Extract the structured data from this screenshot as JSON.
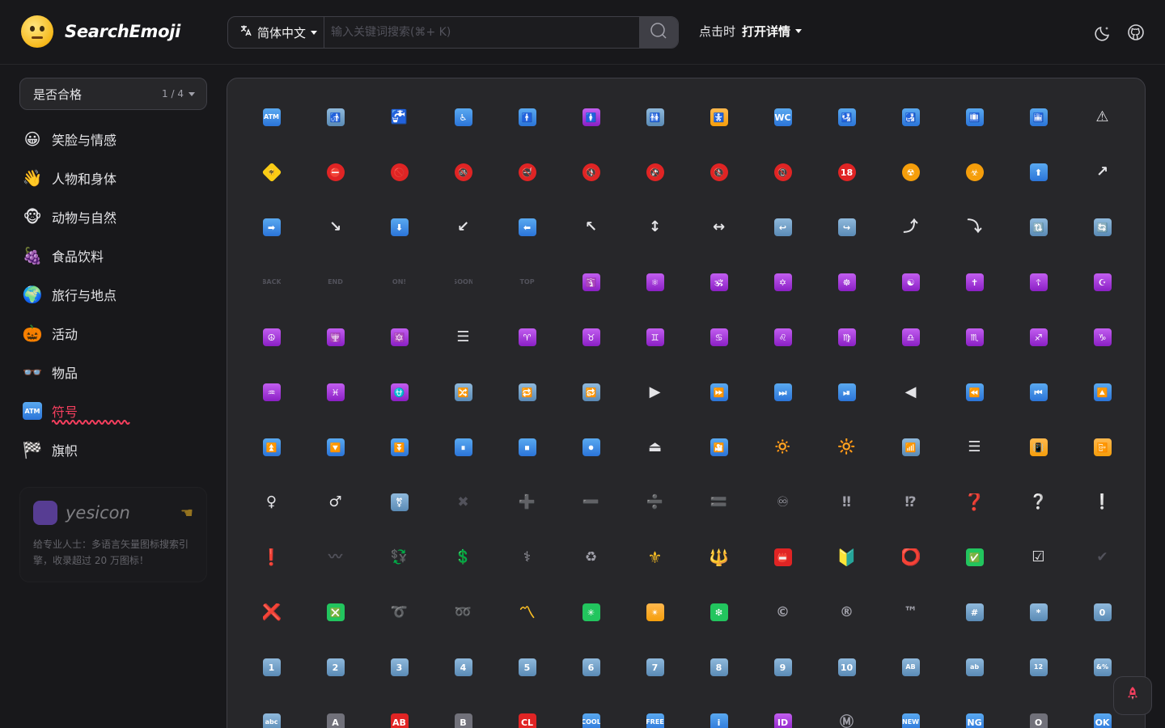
{
  "header": {
    "logo_text": "SearchEmoji",
    "language": "简体中文",
    "search_placeholder": "输入关键词搜索(⌘+ K)",
    "click_label": "点击时",
    "click_value": "打开详情"
  },
  "sidebar": {
    "filter_label": "是否合格",
    "filter_count": "1 / 4",
    "categories": [
      {
        "icon": "😀",
        "label": "笑脸与情感"
      },
      {
        "icon": "👋",
        "label": "人物和身体"
      },
      {
        "icon": "🐵",
        "label": "动物与自然"
      },
      {
        "icon": "🍇",
        "label": "食品饮料"
      },
      {
        "icon": "🌍",
        "label": "旅行与地点"
      },
      {
        "icon": "🎃",
        "label": "活动"
      },
      {
        "icon": "👓",
        "label": "物品"
      },
      {
        "icon": "ATM",
        "label": "符号"
      },
      {
        "icon": "🏁",
        "label": "旗帜"
      }
    ],
    "active_index": 7,
    "promo": {
      "brand": "yesicon",
      "description": "给专业人士：多语言矢量图标搜索引擎，收录超过 20 万图标！"
    }
  },
  "emojis": [
    {
      "c": "ATM",
      "s": "blue sm"
    },
    {
      "c": "🚮",
      "s": "lblue"
    },
    {
      "c": "🚰",
      "s": "grayplain"
    },
    {
      "c": "♿",
      "s": "blue"
    },
    {
      "c": "🚹",
      "s": "blue"
    },
    {
      "c": "🚺",
      "s": "purple"
    },
    {
      "c": "🚻",
      "s": "lblue"
    },
    {
      "c": "🚼",
      "s": "orange"
    },
    {
      "c": "WC",
      "s": "blue"
    },
    {
      "c": "🛂",
      "s": "blue"
    },
    {
      "c": "🛃",
      "s": "blue"
    },
    {
      "c": "🛄",
      "s": "blue"
    },
    {
      "c": "🛅",
      "s": "blue"
    },
    {
      "c": "⚠",
      "s": "whiteplain"
    },
    {
      "c": "🚸",
      "s": "yellow"
    },
    {
      "c": "⛔",
      "s": "redc"
    },
    {
      "c": "🚫",
      "s": "redc"
    },
    {
      "c": "🚳",
      "s": "redc"
    },
    {
      "c": "🚭",
      "s": "redc"
    },
    {
      "c": "🚯",
      "s": "redc"
    },
    {
      "c": "🚱",
      "s": "redc"
    },
    {
      "c": "🚷",
      "s": "redc"
    },
    {
      "c": "📵",
      "s": "redc"
    },
    {
      "c": "18",
      "s": "redc"
    },
    {
      "c": "☢",
      "s": "orangec"
    },
    {
      "c": "☣",
      "s": "orangec"
    },
    {
      "c": "⬆",
      "s": "blue"
    },
    {
      "c": "↗",
      "s": "whiteplain"
    },
    {
      "c": "➡",
      "s": "blue"
    },
    {
      "c": "↘",
      "s": "whiteplain"
    },
    {
      "c": "⬇",
      "s": "blue"
    },
    {
      "c": "↙",
      "s": "whiteplain"
    },
    {
      "c": "⬅",
      "s": "blue"
    },
    {
      "c": "↖",
      "s": "whiteplain"
    },
    {
      "c": "↕",
      "s": "whiteplain"
    },
    {
      "c": "↔",
      "s": "whiteplain"
    },
    {
      "c": "↩",
      "s": "lblue"
    },
    {
      "c": "↪",
      "s": "lblue"
    },
    {
      "c": "⤴",
      "s": "whiteplain"
    },
    {
      "c": "⤵",
      "s": "whiteplain"
    },
    {
      "c": "🔃",
      "s": "lblue"
    },
    {
      "c": "🔄",
      "s": "lblue"
    },
    {
      "c": "BACK",
      "s": "dimsm"
    },
    {
      "c": "END",
      "s": "dimsm"
    },
    {
      "c": "ON!",
      "s": "dimsm"
    },
    {
      "c": "SOON",
      "s": "dimsm"
    },
    {
      "c": "TOP",
      "s": "dimsm"
    },
    {
      "c": "🛐",
      "s": "purple"
    },
    {
      "c": "⚛",
      "s": "purple"
    },
    {
      "c": "🕉",
      "s": "purple"
    },
    {
      "c": "✡",
      "s": "purple"
    },
    {
      "c": "☸",
      "s": "purple"
    },
    {
      "c": "☯",
      "s": "purple"
    },
    {
      "c": "✝",
      "s": "purple"
    },
    {
      "c": "☦",
      "s": "purple"
    },
    {
      "c": "☪",
      "s": "purple"
    },
    {
      "c": "☮",
      "s": "purple"
    },
    {
      "c": "🕎",
      "s": "purple"
    },
    {
      "c": "🔯",
      "s": "purple"
    },
    {
      "c": "☰",
      "s": "whiteplain"
    },
    {
      "c": "♈",
      "s": "purple"
    },
    {
      "c": "♉",
      "s": "purple"
    },
    {
      "c": "♊",
      "s": "purple"
    },
    {
      "c": "♋",
      "s": "purple"
    },
    {
      "c": "♌",
      "s": "purple"
    },
    {
      "c": "♍",
      "s": "purple"
    },
    {
      "c": "♎",
      "s": "purple"
    },
    {
      "c": "♏",
      "s": "purple"
    },
    {
      "c": "♐",
      "s": "purple"
    },
    {
      "c": "♑",
      "s": "purple"
    },
    {
      "c": "♒",
      "s": "purple"
    },
    {
      "c": "♓",
      "s": "purple"
    },
    {
      "c": "⛎",
      "s": "purple"
    },
    {
      "c": "🔀",
      "s": "lblue"
    },
    {
      "c": "🔁",
      "s": "lblue"
    },
    {
      "c": "🔂",
      "s": "lblue"
    },
    {
      "c": "▶",
      "s": "whiteplain"
    },
    {
      "c": "⏩",
      "s": "blue"
    },
    {
      "c": "⏭",
      "s": "blue"
    },
    {
      "c": "⏯",
      "s": "blue"
    },
    {
      "c": "◀",
      "s": "whiteplain"
    },
    {
      "c": "⏪",
      "s": "blue"
    },
    {
      "c": "⏮",
      "s": "blue"
    },
    {
      "c": "🔼",
      "s": "blue"
    },
    {
      "c": "⏫",
      "s": "blue"
    },
    {
      "c": "🔽",
      "s": "blue"
    },
    {
      "c": "⏬",
      "s": "blue"
    },
    {
      "c": "⏸",
      "s": "blue"
    },
    {
      "c": "⏹",
      "s": "blue"
    },
    {
      "c": "⏺",
      "s": "blue"
    },
    {
      "c": "⏏",
      "s": "whiteplain"
    },
    {
      "c": "🎦",
      "s": "blue"
    },
    {
      "c": "🔅",
      "s": "orangeplain"
    },
    {
      "c": "🔆",
      "s": "orangeplain"
    },
    {
      "c": "📶",
      "s": "lblue"
    },
    {
      "c": "☰",
      "s": "whiteplain"
    },
    {
      "c": "📳",
      "s": "orange"
    },
    {
      "c": "📴",
      "s": "orange"
    },
    {
      "c": "♀",
      "s": "whiteplain"
    },
    {
      "c": "♂",
      "s": "whiteplain"
    },
    {
      "c": "⚧",
      "s": "lblue"
    },
    {
      "c": "✖",
      "s": "dim"
    },
    {
      "c": "➕",
      "s": "dim"
    },
    {
      "c": "➖",
      "s": "dim"
    },
    {
      "c": "➗",
      "s": "dim"
    },
    {
      "c": "🟰",
      "s": "grayplain"
    },
    {
      "c": "♾",
      "s": "grayplain"
    },
    {
      "c": "‼",
      "s": "grayplain"
    },
    {
      "c": "⁉",
      "s": "grayplain"
    },
    {
      "c": "❓",
      "s": "redplain"
    },
    {
      "c": "❔",
      "s": "whiteplain"
    },
    {
      "c": "❕",
      "s": "whiteplain"
    },
    {
      "c": "❗",
      "s": "redplain"
    },
    {
      "c": "〰",
      "s": "dim"
    },
    {
      "c": "💱",
      "s": "dim"
    },
    {
      "c": "💲",
      "s": "dim"
    },
    {
      "c": "⚕",
      "s": "grayplain"
    },
    {
      "c": "♻",
      "s": "grayplain"
    },
    {
      "c": "⚜",
      "s": "gold"
    },
    {
      "c": "🔱",
      "s": "gold"
    },
    {
      "c": "📛",
      "s": "red"
    },
    {
      "c": "🔰",
      "s": "gold"
    },
    {
      "c": "⭕",
      "s": "redplain"
    },
    {
      "c": "✅",
      "s": "green"
    },
    {
      "c": "☑",
      "s": "whiteplain"
    },
    {
      "c": "✔",
      "s": "dim"
    },
    {
      "c": "❌",
      "s": "redplain"
    },
    {
      "c": "❎",
      "s": "green"
    },
    {
      "c": "➰",
      "s": "dim"
    },
    {
      "c": "➿",
      "s": "dim"
    },
    {
      "c": "〽",
      "s": "gold"
    },
    {
      "c": "✳",
      "s": "green"
    },
    {
      "c": "✴",
      "s": "orange"
    },
    {
      "c": "❇",
      "s": "green"
    },
    {
      "c": "©",
      "s": "grayplain"
    },
    {
      "c": "®",
      "s": "grayplain"
    },
    {
      "c": "™",
      "s": "grayplain"
    },
    {
      "c": "#",
      "s": "lblue"
    },
    {
      "c": "*",
      "s": "lblue"
    },
    {
      "c": "0",
      "s": "lblue"
    },
    {
      "c": "1",
      "s": "lblue"
    },
    {
      "c": "2",
      "s": "lblue"
    },
    {
      "c": "3",
      "s": "lblue"
    },
    {
      "c": "4",
      "s": "lblue"
    },
    {
      "c": "5",
      "s": "lblue"
    },
    {
      "c": "6",
      "s": "lblue"
    },
    {
      "c": "7",
      "s": "lblue"
    },
    {
      "c": "8",
      "s": "lblue"
    },
    {
      "c": "9",
      "s": "lblue"
    },
    {
      "c": "10",
      "s": "lblue"
    },
    {
      "c": "AB",
      "s": "lblue sm"
    },
    {
      "c": "ab",
      "s": "lblue sm"
    },
    {
      "c": "12",
      "s": "lblue sm"
    },
    {
      "c": "&%",
      "s": "lblue sm"
    },
    {
      "c": "abc",
      "s": "lblue sm"
    },
    {
      "c": "A",
      "s": "gray"
    },
    {
      "c": "AB",
      "s": "red"
    },
    {
      "c": "B",
      "s": "gray"
    },
    {
      "c": "CL",
      "s": "red"
    },
    {
      "c": "COOL",
      "s": "blue sm"
    },
    {
      "c": "FREE",
      "s": "blue sm"
    },
    {
      "c": "i",
      "s": "blue"
    },
    {
      "c": "ID",
      "s": "purple"
    },
    {
      "c": "Ⓜ",
      "s": "grayplain"
    },
    {
      "c": "NEW",
      "s": "blue sm"
    },
    {
      "c": "NG",
      "s": "blue"
    },
    {
      "c": "O",
      "s": "gray"
    },
    {
      "c": "OK",
      "s": "blue"
    }
  ]
}
